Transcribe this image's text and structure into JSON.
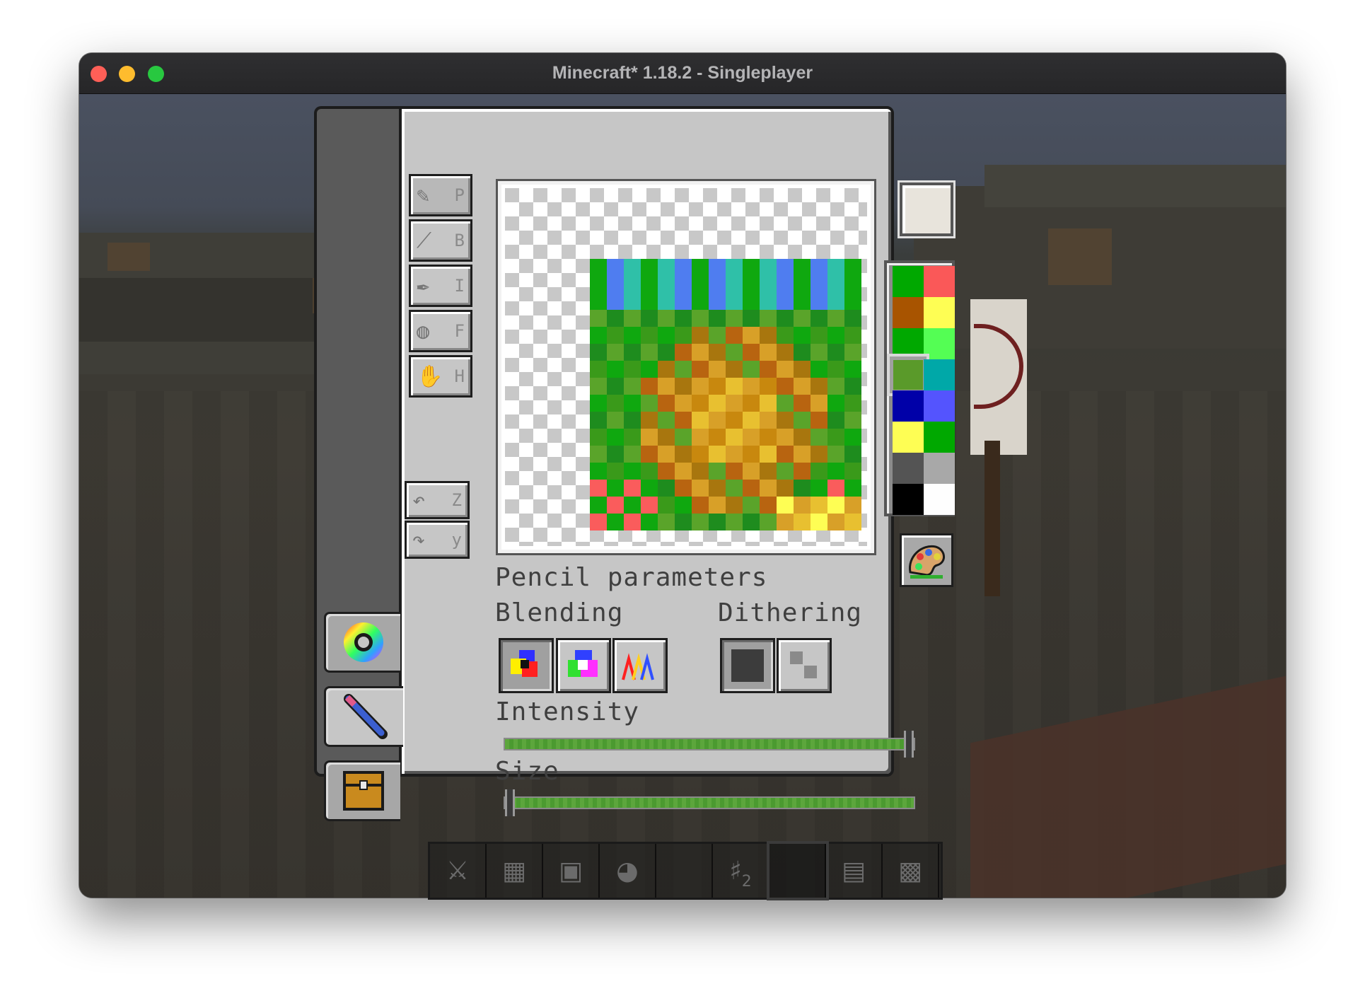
{
  "window": {
    "title": "Minecraft* 1.18.2 - Singleplayer"
  },
  "tools": [
    {
      "icon": "pencil-icon",
      "key": "P"
    },
    {
      "icon": "brush-icon",
      "key": "B"
    },
    {
      "icon": "color-picker-icon",
      "key": "I"
    },
    {
      "icon": "fill-bucket-icon",
      "key": "F"
    },
    {
      "icon": "hand-icon",
      "key": "H"
    }
  ],
  "history": {
    "undo_key": "Z",
    "redo_key": "y"
  },
  "panel": {
    "heading": "Pencil parameters",
    "blending_label": "Blending",
    "dithering_label": "Dithering",
    "intensity_label": "Intensity",
    "size_label": "Size",
    "intensity_value": 1.0,
    "size_value": 0.0
  },
  "colors": {
    "current": "#e8e4dc",
    "palette": [
      "#00a800",
      "#fa5858",
      "#a85400",
      "#fefe54",
      "#00a800",
      "#54fe54",
      "#5a9a2a",
      "#00a8a8",
      "#0000a8",
      "#5454fe",
      "#fefe54",
      "#00a800",
      "#545454",
      "#a8a8a8",
      "#000000",
      "#fefefe"
    ],
    "selected_palette_index": 6
  },
  "hotbar": {
    "slot_count_label": "2"
  }
}
